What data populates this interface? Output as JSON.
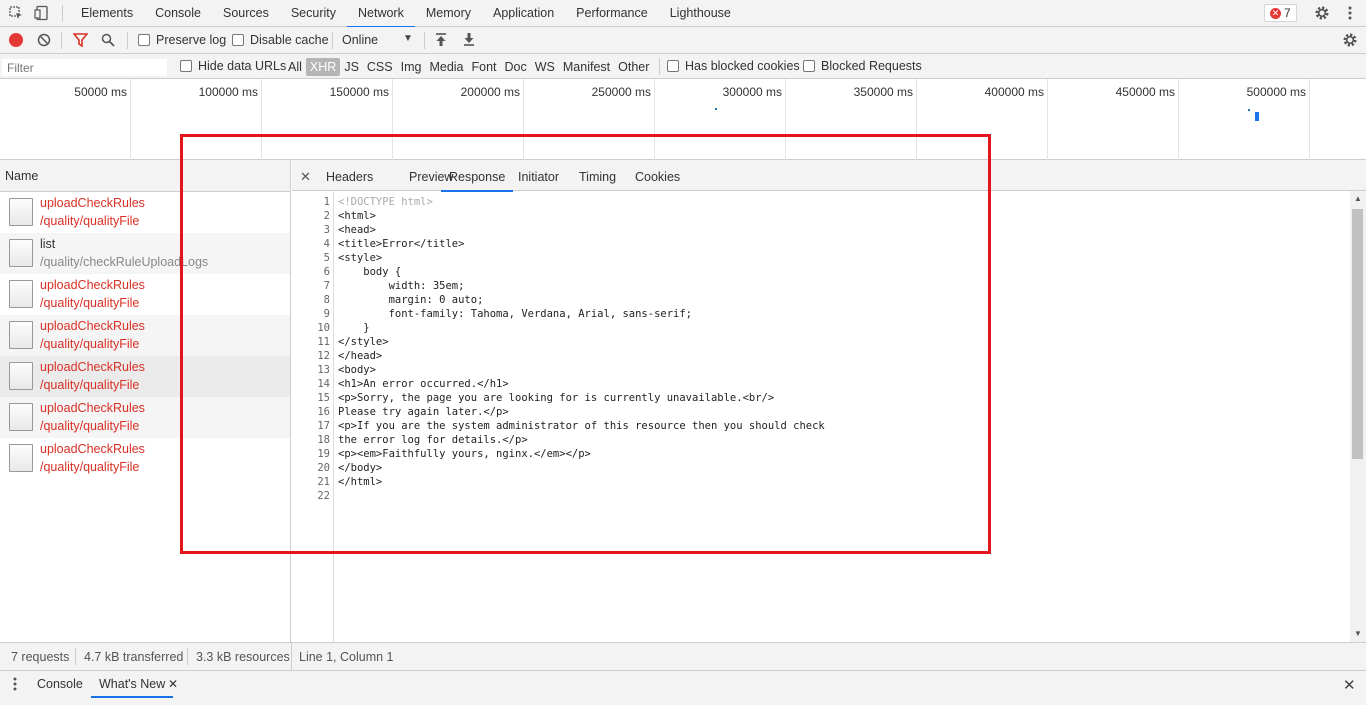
{
  "top_tabs": [
    "Elements",
    "Console",
    "Sources",
    "Security",
    "Network",
    "Memory",
    "Application",
    "Performance",
    "Lighthouse"
  ],
  "active_top_tab": "Network",
  "error_count": "7",
  "toolbar": {
    "preserve_log": "Preserve log",
    "disable_cache": "Disable cache",
    "throttling": "Online"
  },
  "filterbar": {
    "filter_placeholder": "Filter",
    "hide_data_urls": "Hide data URLs",
    "types": [
      "All",
      "XHR",
      "JS",
      "CSS",
      "Img",
      "Media",
      "Font",
      "Doc",
      "WS",
      "Manifest",
      "Other"
    ],
    "active_type": "XHR",
    "has_blocked_cookies": "Has blocked cookies",
    "blocked_requests": "Blocked Requests"
  },
  "overview_ticks": [
    "50000 ms",
    "100000 ms",
    "150000 ms",
    "200000 ms",
    "250000 ms",
    "300000 ms",
    "350000 ms",
    "400000 ms",
    "450000 ms",
    "500000 ms"
  ],
  "request_list": {
    "header": "Name",
    "rows": [
      {
        "name": "uploadCheckRules",
        "path": "/quality/qualityFile",
        "error": true
      },
      {
        "name": "list",
        "path": "/quality/checkRuleUploadLogs",
        "error": false
      },
      {
        "name": "uploadCheckRules",
        "path": "/quality/qualityFile",
        "error": true
      },
      {
        "name": "uploadCheckRules",
        "path": "/quality/qualityFile",
        "error": true
      },
      {
        "name": "uploadCheckRules",
        "path": "/quality/qualityFile",
        "error": true
      },
      {
        "name": "uploadCheckRules",
        "path": "/quality/qualityFile",
        "error": true
      },
      {
        "name": "uploadCheckRules",
        "path": "/quality/qualityFile",
        "error": true
      }
    ]
  },
  "detail_tabs": [
    "Headers",
    "Preview",
    "Response",
    "Initiator",
    "Timing",
    "Cookies"
  ],
  "active_detail_tab": "Response",
  "response_lines": [
    "<!DOCTYPE html>",
    "<html>",
    "<head>",
    "<title>Error</title>",
    "<style>",
    "    body {",
    "        width: 35em;",
    "        margin: 0 auto;",
    "        font-family: Tahoma, Verdana, Arial, sans-serif;",
    "    }",
    "</style>",
    "</head>",
    "<body>",
    "<h1>An error occurred.</h1>",
    "<p>Sorry, the page you are looking for is currently unavailable.<br/>",
    "Please try again later.</p>",
    "<p>If you are the system administrator of this resource then you should check",
    "the error log for details.</p>",
    "<p><em>Faithfully yours, nginx.</em></p>",
    "</body>",
    "</html>",
    ""
  ],
  "status": {
    "requests": "7 requests",
    "transferred": "4.7 kB transferred",
    "resources": "3.3 kB resources",
    "cursor": "Line 1, Column 1"
  },
  "drawer": {
    "tabs": [
      "Console",
      "What's New"
    ],
    "active": "What's New"
  },
  "colors": {
    "accent": "#1a73e8",
    "error_red": "#d93025",
    "highlight_red": "#e3141a",
    "record_red": "#e53935"
  }
}
